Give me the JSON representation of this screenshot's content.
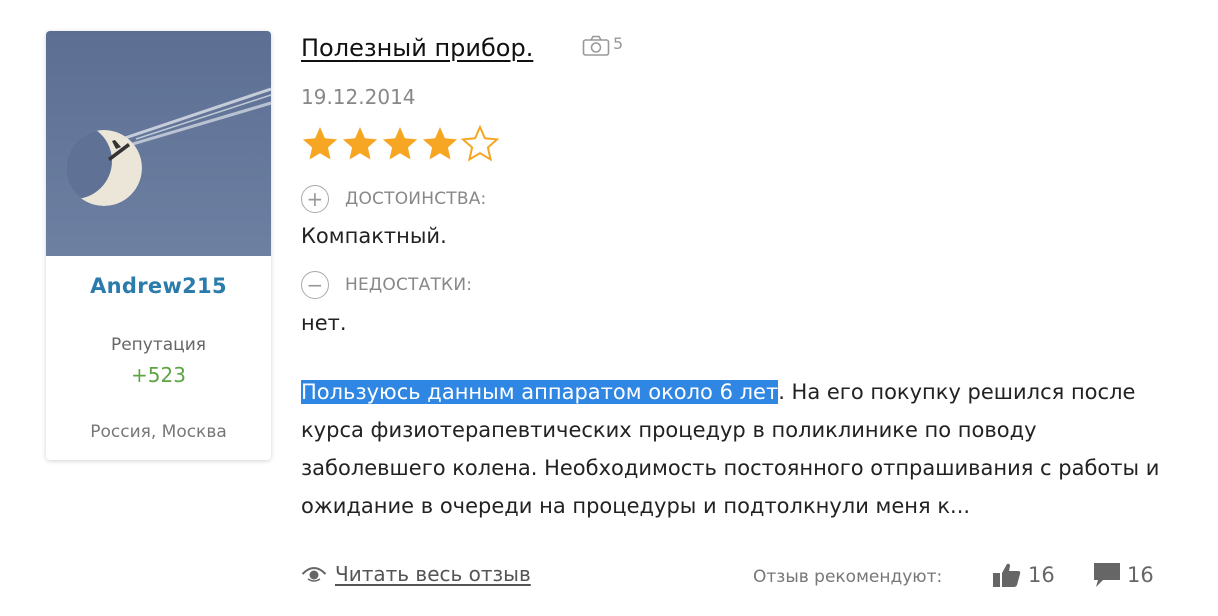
{
  "author": {
    "avatar_icon": "moon-airplane-photo",
    "name": "Andrew215",
    "reputation_label": "Репутация",
    "reputation_value": "+523",
    "location": "Россия, Москва"
  },
  "review": {
    "title": "Полезный прибор.",
    "photo_icon": "camera-icon",
    "photo_count": "5",
    "date": "19.12.2014",
    "rating": 4,
    "rating_max": 5,
    "pros_label": "ДОСТОИНСТВА:",
    "pros_text": "Компактный.",
    "cons_label": "НЕДОСТАТКИ:",
    "cons_text": "нет.",
    "body_highlight": "Пользуюсь данным аппаратом около 6 лет",
    "body_rest": ". На его покупку решился после курса физиотерапевтических процедур в поликлинике по поводу заболевшего колена. Необходимость постоянного отпрашивания с работы и ожидание в очереди на процедуры и подтолкнули меня к..."
  },
  "footer": {
    "read_more": "Читать весь отзыв",
    "recommend_label": "Отзыв рекомендуют:",
    "likes": "16",
    "comments": "16"
  },
  "colors": {
    "accent": "#2b7bab",
    "star": "#f6a623",
    "reputation": "#5da544",
    "highlight": "#2f86e3"
  }
}
